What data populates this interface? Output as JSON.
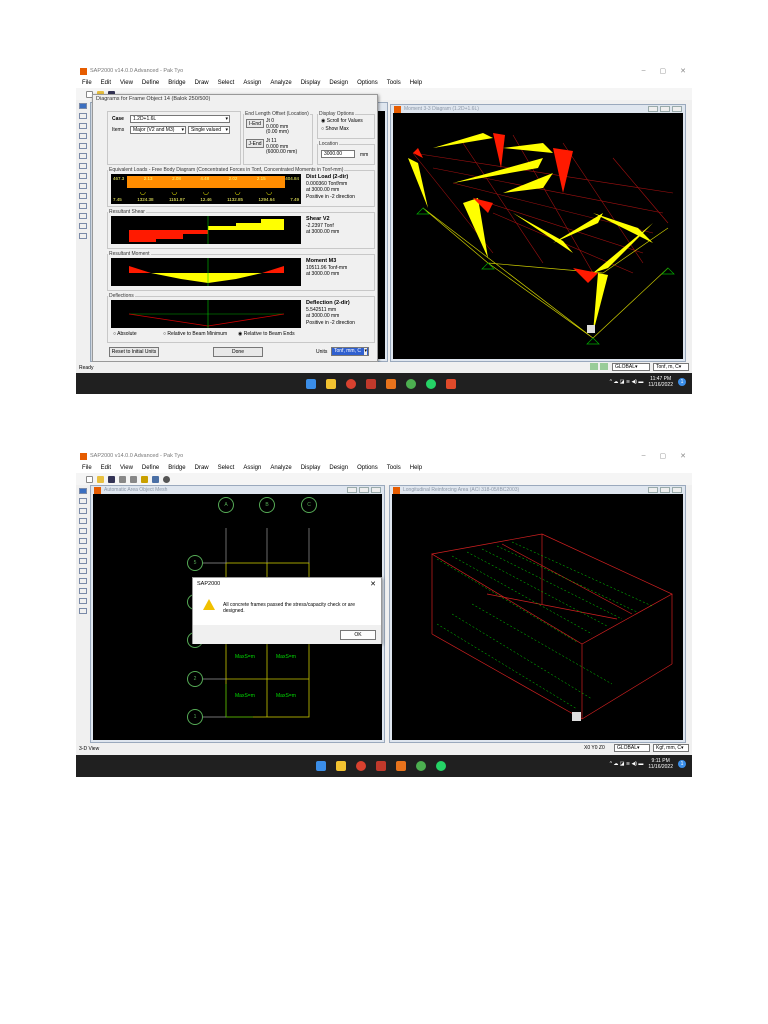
{
  "app_title": "SAP2000 v14.0.0 Advanced - Pak Tyo",
  "menu": [
    "File",
    "Edit",
    "View",
    "Define",
    "Bridge",
    "Draw",
    "Select",
    "Assign",
    "Analyze",
    "Display",
    "Design",
    "Options",
    "Tools",
    "Help"
  ],
  "colors": {
    "positive": "#ffff00",
    "negative": "#ff1a00",
    "load_bar": "#ff8c00",
    "grid": "#c8c800",
    "model": "#00cc00"
  },
  "shot1": {
    "dialog": {
      "title": "Diagrams for Frame Object 14  (Balok 250/500)",
      "case_label": "Case",
      "case_value": "1.2D+1.6L",
      "items_label": "Items",
      "items_value": "Major (V2 and M3)",
      "items_mode": "Single valued",
      "end_offset_title": "End Length Offset (Location)",
      "i_end_btn": "I-End",
      "i_end_jt": "Jt  0",
      "i_end_val1": "0.000 mm",
      "i_end_val2": "(0.00 mm)",
      "j_end_btn": "J-End",
      "j_end_jt": "Jt  11",
      "j_end_val1": "0.000 mm",
      "j_end_val2": "(6000.00 mm)",
      "display_options_title": "Display Options",
      "opt_scroll": "Scroll for Values",
      "opt_max": "Show Max",
      "location_title": "Location",
      "location_value": "3000.00",
      "location_unit": "mm",
      "loads_title": "Equivalent Loads - Free Body Diagram  (Concentrated Forces in Tonf, Concentrated Moments in Tonf-mm)",
      "load_top_labels": [
        "467.3",
        "2.13",
        "2.08",
        "4.48",
        "2.02",
        "2.15",
        "404.84"
      ],
      "load_bottom_labels": [
        "7.45",
        "1324.38",
        "1151.97",
        "12.46",
        "1132.85",
        "1294.64",
        "7.49"
      ],
      "dist_load_title": "Dist Load (2-dir)",
      "dist_load_value": "0.000360 Tonf/mm",
      "dist_load_at": "at 3000.00 mm",
      "dist_load_dir": "Positive in -2 direction",
      "shear_title": "Resultant Shear",
      "shear_label": "Shear V2",
      "shear_value": "-2.2397 Tonf",
      "shear_at": "at 3000.00 mm",
      "moment_title": "Resultant Moment",
      "moment_label": "Moment M3",
      "moment_value": "10511.96 Tonf-mm",
      "moment_at": "at 3000.00 mm",
      "defl_title": "Deflections",
      "defl_label": "Deflection (2-dir)",
      "defl_value": "5.542511 mm",
      "defl_at": "at 3000.00 mm",
      "defl_dir": "Positive in -2 direction",
      "radio_absolute": "Absolute",
      "radio_rel_min": "Relative to Beam Minimum",
      "radio_rel_ends": "Relative to Beam Ends",
      "reset_btn": "Reset to Initial Units",
      "done_btn": "Done",
      "units_label": "Units",
      "units_value": "Tonf, mm, C"
    },
    "right_view_title": "Moment 3-3 Diagram   (1.2D+1.6L)",
    "status_text": "Ready",
    "coord_system": "GLOBAL",
    "units": "Tonf, m, C",
    "clock_time": "11:47 PM",
    "clock_date": "11/16/2022",
    "notification_count": "1"
  },
  "shot2": {
    "left_view_title": "Automatic Area Object Mesh",
    "right_view_title": "Longitudinal Reinforcing Area  (ACI 318-05/IBC2003)",
    "grid_cols": [
      "A",
      "B",
      "C"
    ],
    "grid_rows": [
      "5",
      "4",
      "3",
      "2",
      "1"
    ],
    "mesh_label": "MaxS=m",
    "msgbox": {
      "title": "SAP2000",
      "message": "All concrete frames passed the stress/capacity check or are designed.",
      "ok": "OK"
    },
    "status_text": "3-D View",
    "coords": "X0 Y0 Z0",
    "coord_system": "GLOBAL",
    "units": "Kgf, mm, C",
    "clock_time": "9:11 PM",
    "clock_date": "11/16/2022",
    "notification_count": "1"
  }
}
